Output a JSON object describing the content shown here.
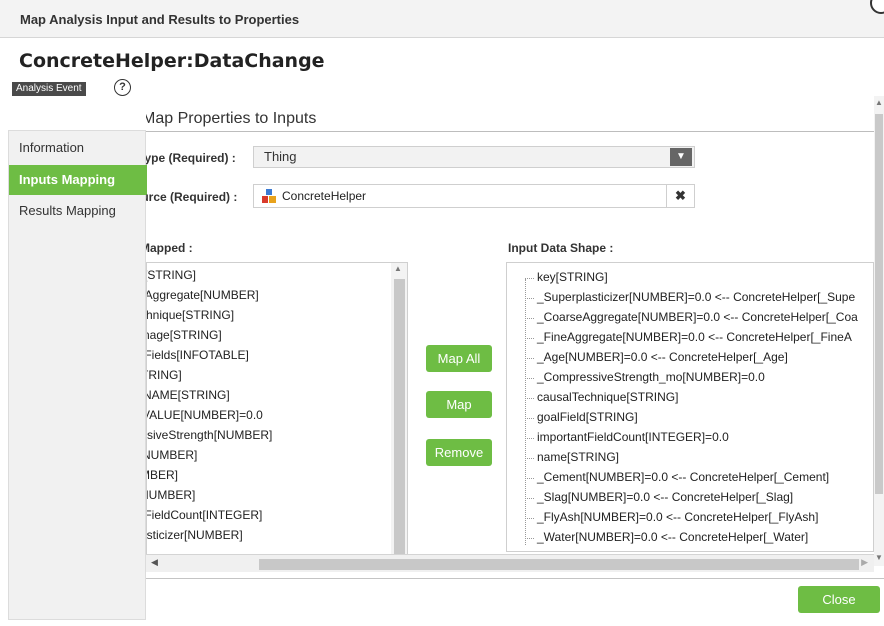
{
  "dialog": {
    "title": "Map Analysis Input and Results to Properties"
  },
  "header": {
    "name": "ConcreteHelper:DataChange",
    "badge": "Analysis Event",
    "help_glyph": "?"
  },
  "sidebar": {
    "items": [
      {
        "label": "Information",
        "active": false
      },
      {
        "label": "Inputs Mapping",
        "active": true
      },
      {
        "label": "Results Mapping",
        "active": false
      }
    ]
  },
  "inputs_mapping": {
    "section_title": "Map Properties to Inputs",
    "type_label": "Type (Required) :",
    "type_value": "Thing",
    "source_label": "Source (Required) :",
    "source_value": "ConcreteHelper",
    "source_icon": "thing-icon",
    "to_be_mapped_label": "Mapped :",
    "to_be_mapped": [
      "[STRING]",
      "eAggregate[NUMBER]",
      "chnique[STRING]",
      "nage[STRING]",
      "tFields[INFOTABLE]",
      "TRING]",
      "NAME[STRING]",
      "VALUE[NUMBER]=0.0",
      "ssiveStrength[NUMBER]",
      "NUMBER]",
      "MBER]",
      "NUMBER]",
      "tFieldCount[INTEGER]",
      "asticizer[NUMBER]"
    ],
    "buttons": {
      "map_all": "Map All",
      "map": "Map",
      "remove": "Remove"
    },
    "input_shape_label": "Input Data Shape :",
    "input_shape": [
      "key[STRING]",
      "_Superplasticizer[NUMBER]=0.0 <-- ConcreteHelper[_Supe",
      "_CoarseAggregate[NUMBER]=0.0 <-- ConcreteHelper[_Coa",
      "_FineAggregate[NUMBER]=0.0 <-- ConcreteHelper[_FineA",
      "_Age[NUMBER]=0.0 <-- ConcreteHelper[_Age]",
      "_CompressiveStrength_mo[NUMBER]=0.0",
      "causalTechnique[STRING]",
      "goalField[STRING]",
      "importantFieldCount[INTEGER]=0.0",
      "name[STRING]",
      "_Cement[NUMBER]=0.0 <-- ConcreteHelper[_Cement]",
      "_Slag[NUMBER]=0.0 <-- ConcreteHelper[_Slag]",
      "_FlyAsh[NUMBER]=0.0 <-- ConcreteHelper[_FlyAsh]",
      "_Water[NUMBER]=0.0 <-- ConcreteHelper[_Water]"
    ]
  },
  "footer": {
    "close_label": "Close"
  },
  "colors": {
    "accent": "#6ebd44",
    "badge_bg": "#4a4a4a"
  }
}
